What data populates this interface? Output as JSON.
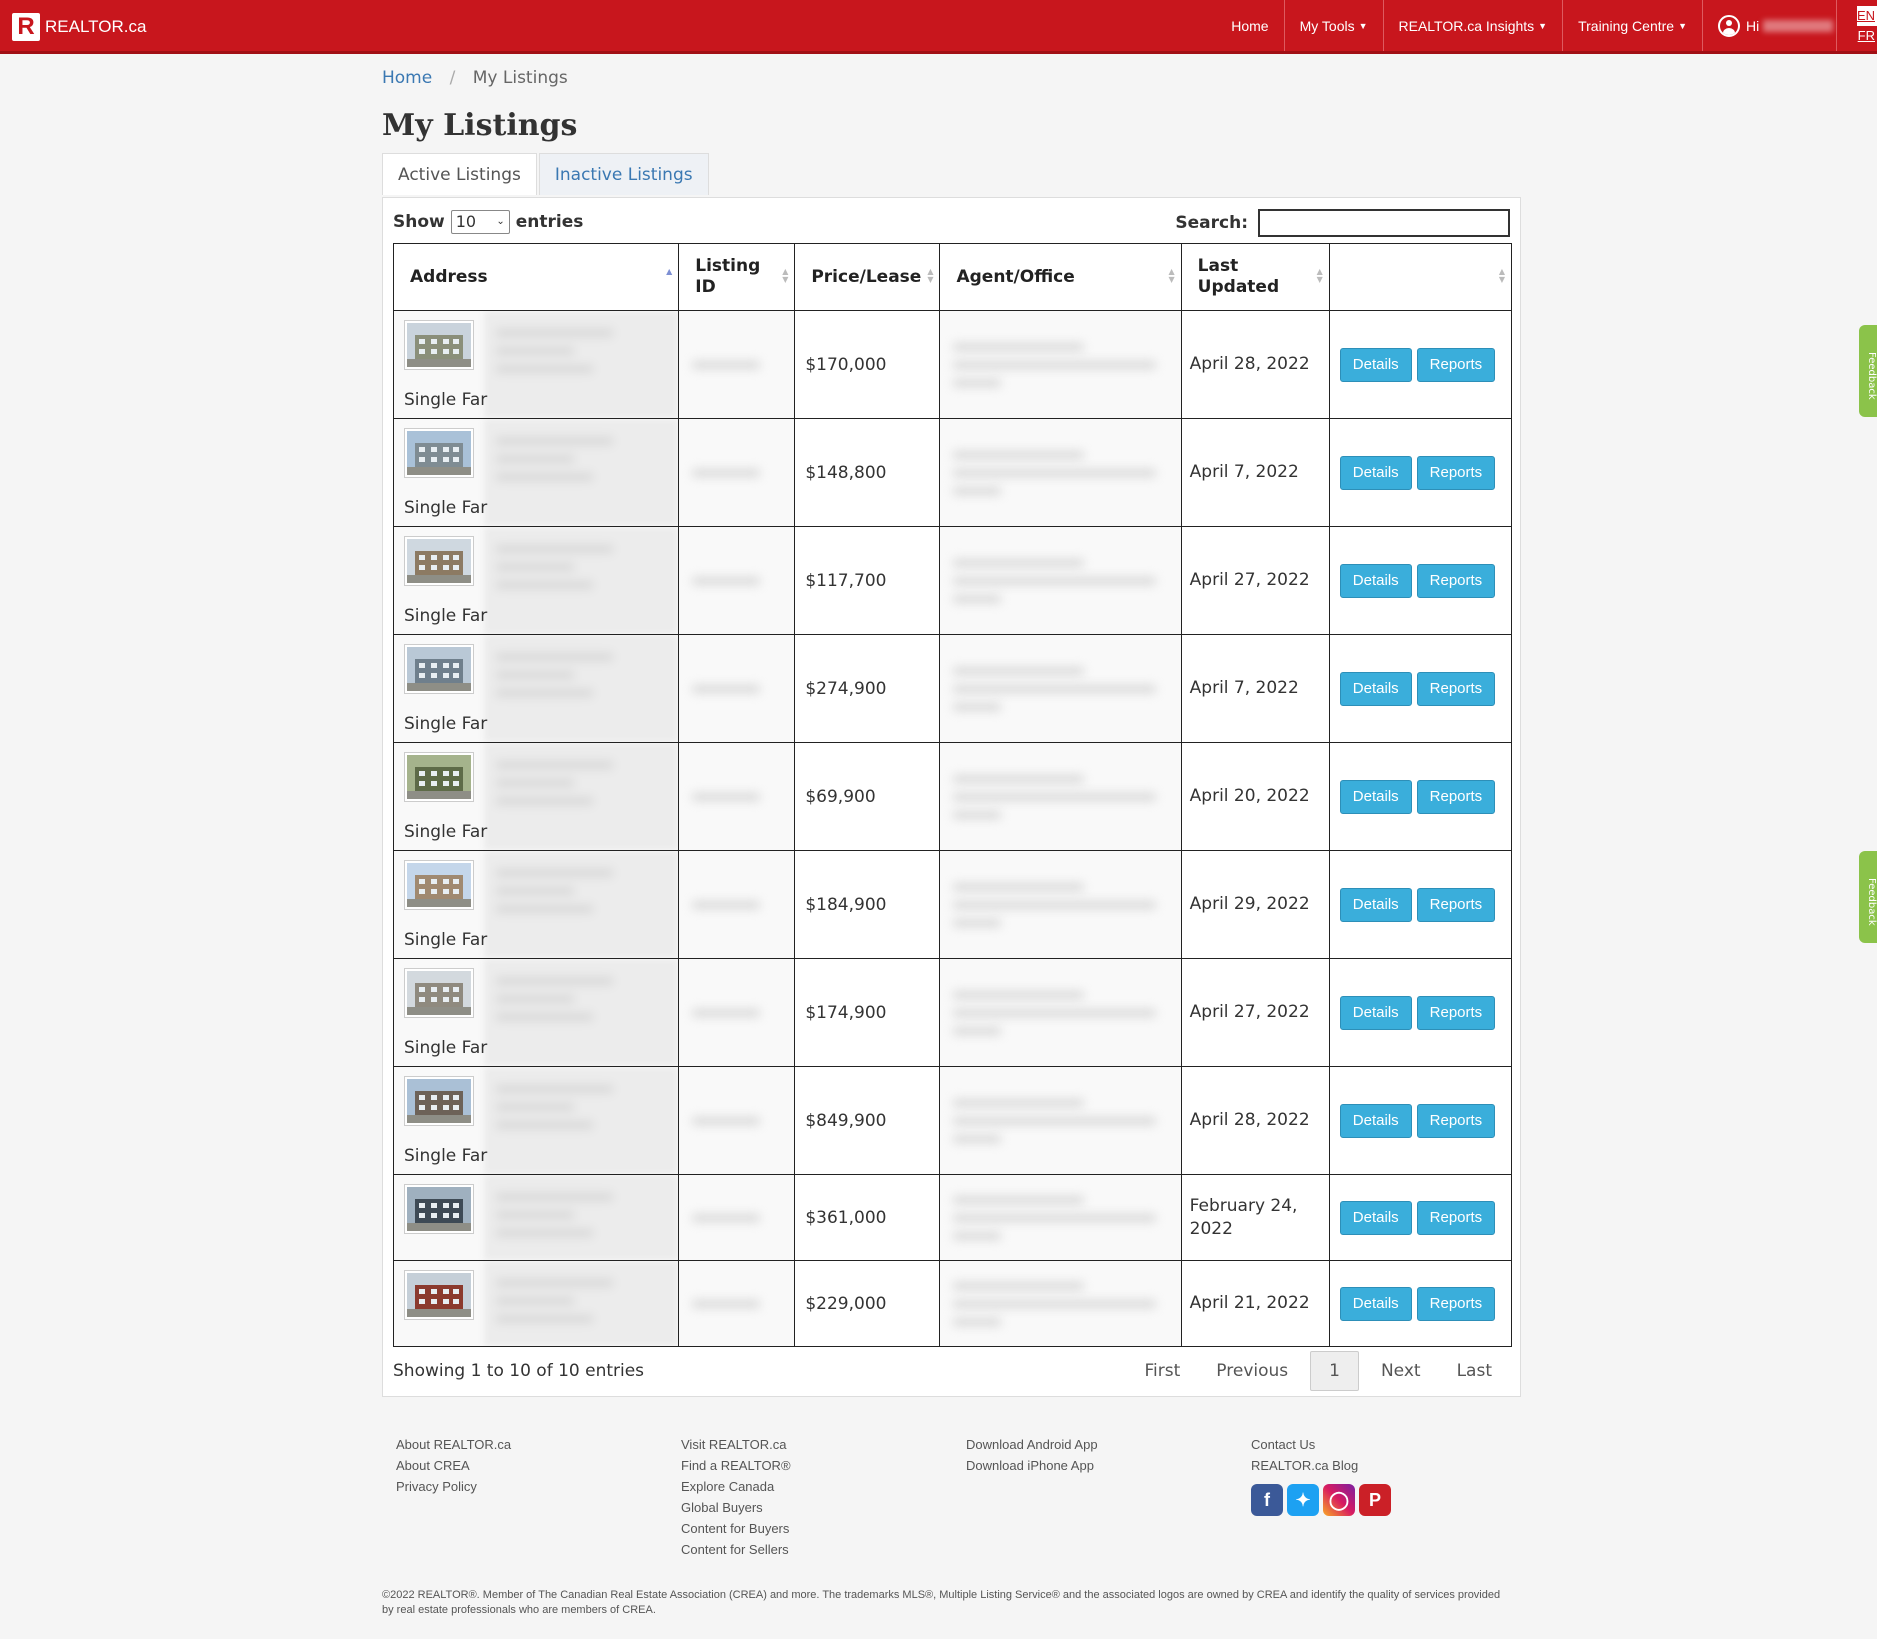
{
  "header": {
    "brand": "REALTOR.ca",
    "brand_mark": "R",
    "nav": [
      "Home",
      "My Tools",
      "REALTOR.ca Insights",
      "Training Centre"
    ],
    "greeting": "Hi",
    "lang_en": "EN",
    "lang_fr": "FR"
  },
  "feedback_label": "Feedback",
  "breadcrumb": {
    "home": "Home",
    "current": "My Listings"
  },
  "page_title": "My Listings",
  "tabs": {
    "active": "Active Listings",
    "inactive": "Inactive Listings"
  },
  "controls": {
    "show": "Show",
    "entries_value": "10",
    "entries": "entries",
    "search_label": "Search:",
    "search_value": ""
  },
  "table": {
    "headers": {
      "address": "Address",
      "listing_id": "Listing ID",
      "price": "Price/Lease",
      "agent": "Agent/Office",
      "updated": "Last Updated"
    },
    "rows": [
      {
        "type": "Single Far",
        "price": "$170,000",
        "updated": "April 28, 2022"
      },
      {
        "type": "Single Far",
        "price": "$148,800",
        "updated": "April 7, 2022"
      },
      {
        "type": "Single Far",
        "price": "$117,700",
        "updated": "April 27, 2022"
      },
      {
        "type": "Single Far",
        "price": "$274,900",
        "updated": "April 7, 2022"
      },
      {
        "type": "Single Far",
        "price": "$69,900",
        "updated": "April 20, 2022"
      },
      {
        "type": "Single Far",
        "price": "$184,900",
        "updated": "April 29, 2022"
      },
      {
        "type": "Single Far",
        "price": "$174,900",
        "updated": "April 27, 2022"
      },
      {
        "type": "Single Far",
        "price": "$849,900",
        "updated": "April 28, 2022"
      },
      {
        "type": "",
        "price": "$361,000",
        "updated": "February 24, 2022"
      },
      {
        "type": "",
        "price": "$229,000",
        "updated": "April 21, 2022"
      }
    ],
    "details_label": "Details",
    "reports_label": "Reports"
  },
  "info": "Showing 1 to 10 of 10 entries",
  "pagination": {
    "first": "First",
    "previous": "Previous",
    "current": "1",
    "next": "Next",
    "last": "Last"
  },
  "footer": {
    "col1": [
      "About REALTOR.ca",
      "About CREA",
      "Privacy Policy"
    ],
    "col2": [
      "Visit REALTOR.ca",
      "Find a REALTOR®",
      "Explore Canada",
      "Global Buyers",
      "Content for Buyers",
      "Content for Sellers"
    ],
    "col3": [
      "Download Android App",
      "Download iPhone App"
    ],
    "col4": [
      "Contact Us",
      "REALTOR.ca Blog"
    ],
    "social_icons": [
      "facebook-icon",
      "twitter-icon",
      "instagram-icon",
      "pinterest-icon"
    ],
    "copyright": "©2022 REALTOR®. Member of The Canadian Real Estate Association (CREA) and more. The trademarks MLS®, Multiple Listing Service® and the associated logos are owned by CREA and identify the quality of services provided by real estate professionals who are members of CREA."
  },
  "colors": {
    "brand_red": "#c8161d",
    "button_blue": "#3aaedb",
    "link_blue": "#3a78b2",
    "feedback_green": "#8bc34a"
  }
}
